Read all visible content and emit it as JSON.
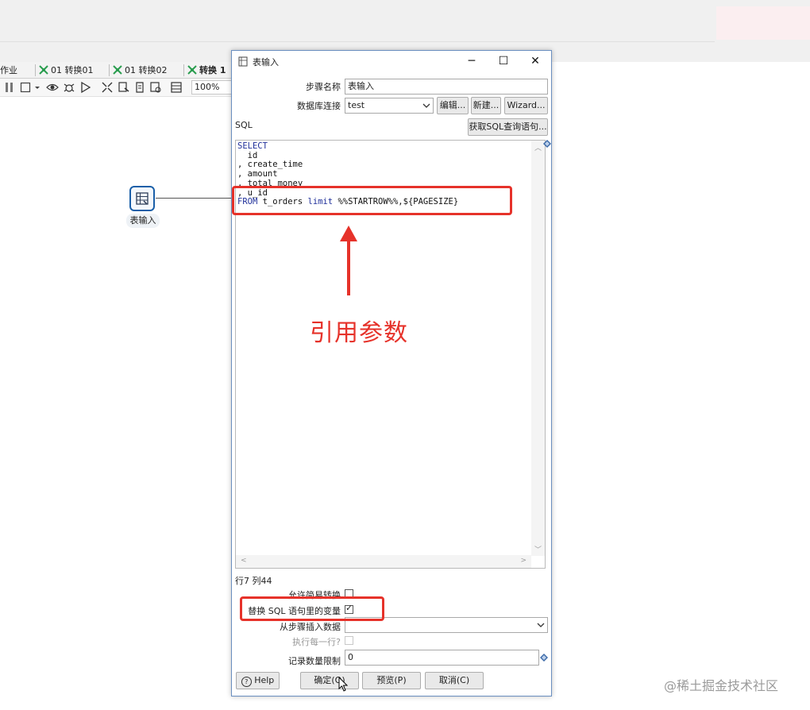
{
  "app": {
    "tabs": [
      {
        "label": "作业"
      },
      {
        "label": "01 转换01"
      },
      {
        "label": "01 转换02"
      },
      {
        "label": "转换 1"
      }
    ],
    "zoom": "100%",
    "canvas_step_label": "表输入"
  },
  "dialog": {
    "title": "表输入",
    "step_name_label": "步骤名称",
    "step_name_value": "表输入",
    "db_conn_label": "数据库连接",
    "db_conn_value": "test",
    "edit_button": "编辑...",
    "new_button": "新建...",
    "wizard_button": "Wizard...",
    "sql_label": "SQL",
    "get_sql_button": "获取SQL查询语句...",
    "sql_lines": {
      "l1": "SELECT",
      "l2": "  id",
      "l3": ", create_time",
      "l4": ", amount",
      "l5": ", total_money",
      "l6": ", u_id",
      "l7_kw1": "FROM",
      "l7_mid": " t_orders ",
      "l7_kw2": "limit",
      "l7_rest": " %%STARTROW%%,${PAGESIZE}"
    },
    "cursor_pos": "行7 列44",
    "lazy_conversion_label": "允许简易转换",
    "replace_vars_label": "替换 SQL 语句里的变量",
    "insert_from_step_label": "从步骤插入数据",
    "execute_each_row_label": "执行每一行?",
    "limit_label": "记录数量限制",
    "limit_value": "0",
    "help_button": "Help",
    "ok_button": "确定(O)",
    "preview_button": "预览(P)",
    "cancel_button": "取消(C)"
  },
  "annotation": {
    "text": "引用参数"
  },
  "watermark": "@稀土掘金技术社区",
  "colors": {
    "annotation_red": "#e6322a",
    "sql_keyword": "#1f2f9a",
    "step_border": "#1a5fa8"
  }
}
